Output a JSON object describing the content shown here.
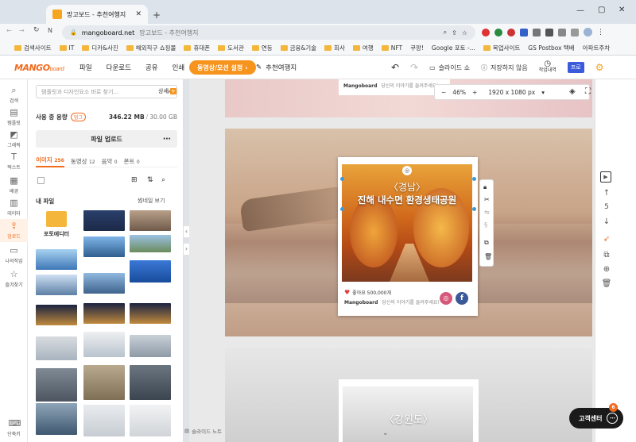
{
  "browser": {
    "tab_title": "망고보드 - 추천여행지",
    "url_domain": "mangoboard.net",
    "url_rest": "망고보드 - 추천여행지",
    "bookmarks": [
      "검색사이트",
      "IT",
      "디카&사진",
      "해외직구 쇼핑몰",
      "휴대폰",
      "도서관",
      "연등",
      "금융&기술",
      "회사",
      "여행",
      "NFT",
      "쿠팡!",
      "Google 포토 -...",
      "목업사이트",
      "GS Postbox 택배",
      "아파트주차"
    ]
  },
  "app": {
    "logo": "MANGO",
    "logo_sub": "board",
    "menu": [
      "파일",
      "다운로드",
      "공유",
      "인쇄"
    ],
    "event_button": "동영상/모션 설정",
    "doc_title": "추천여행지",
    "slideshow": "슬라이드 쇼",
    "save_status": "저장하지 않음",
    "history": "작업내역",
    "pro_badge": "프로"
  },
  "rail": [
    "검색",
    "템플릿",
    "그래픽",
    "텍스트",
    "배경",
    "데이터",
    "업로드",
    "나의작업",
    "즐겨찾기",
    "단축키"
  ],
  "panel": {
    "search_placeholder": "템플릿과 디자인요소 바로 찾기...",
    "detail_link": "상세",
    "usage_label": "사용 중 용량",
    "usage_value": "346.22 MB",
    "usage_total": "30.00 GB",
    "upgrade_badge": "업그",
    "upload_button": "파일 업로드",
    "file_tabs": [
      {
        "label": "이미지",
        "count": "256"
      },
      {
        "label": "동영상",
        "count": "12"
      },
      {
        "label": "음악",
        "count": "0"
      },
      {
        "label": "폰트",
        "count": "0"
      }
    ],
    "my_files": "내 파일",
    "thumb_view": "썸네일 보기",
    "folder_name": "포토에디터"
  },
  "canvas": {
    "zoom": "46%",
    "size": "1920 x 1080 px",
    "brand": "Mangoboard",
    "brand_caption": "당신의 이야기를 들려주세요!",
    "likes": "좋아요 500,000개",
    "card_region": "〈경남〉",
    "card_title": "진해 내수면 환경생태공원",
    "next_region": "〈강원도〉"
  },
  "right_rail": {
    "page_num": "5"
  },
  "help_center": "고객센터",
  "help_badge": "6",
  "bottom_note": "슬라이드 노트",
  "colors": {
    "brand": "#f26b1d",
    "event": "#f7941d",
    "pro": "#3b5bdb"
  }
}
